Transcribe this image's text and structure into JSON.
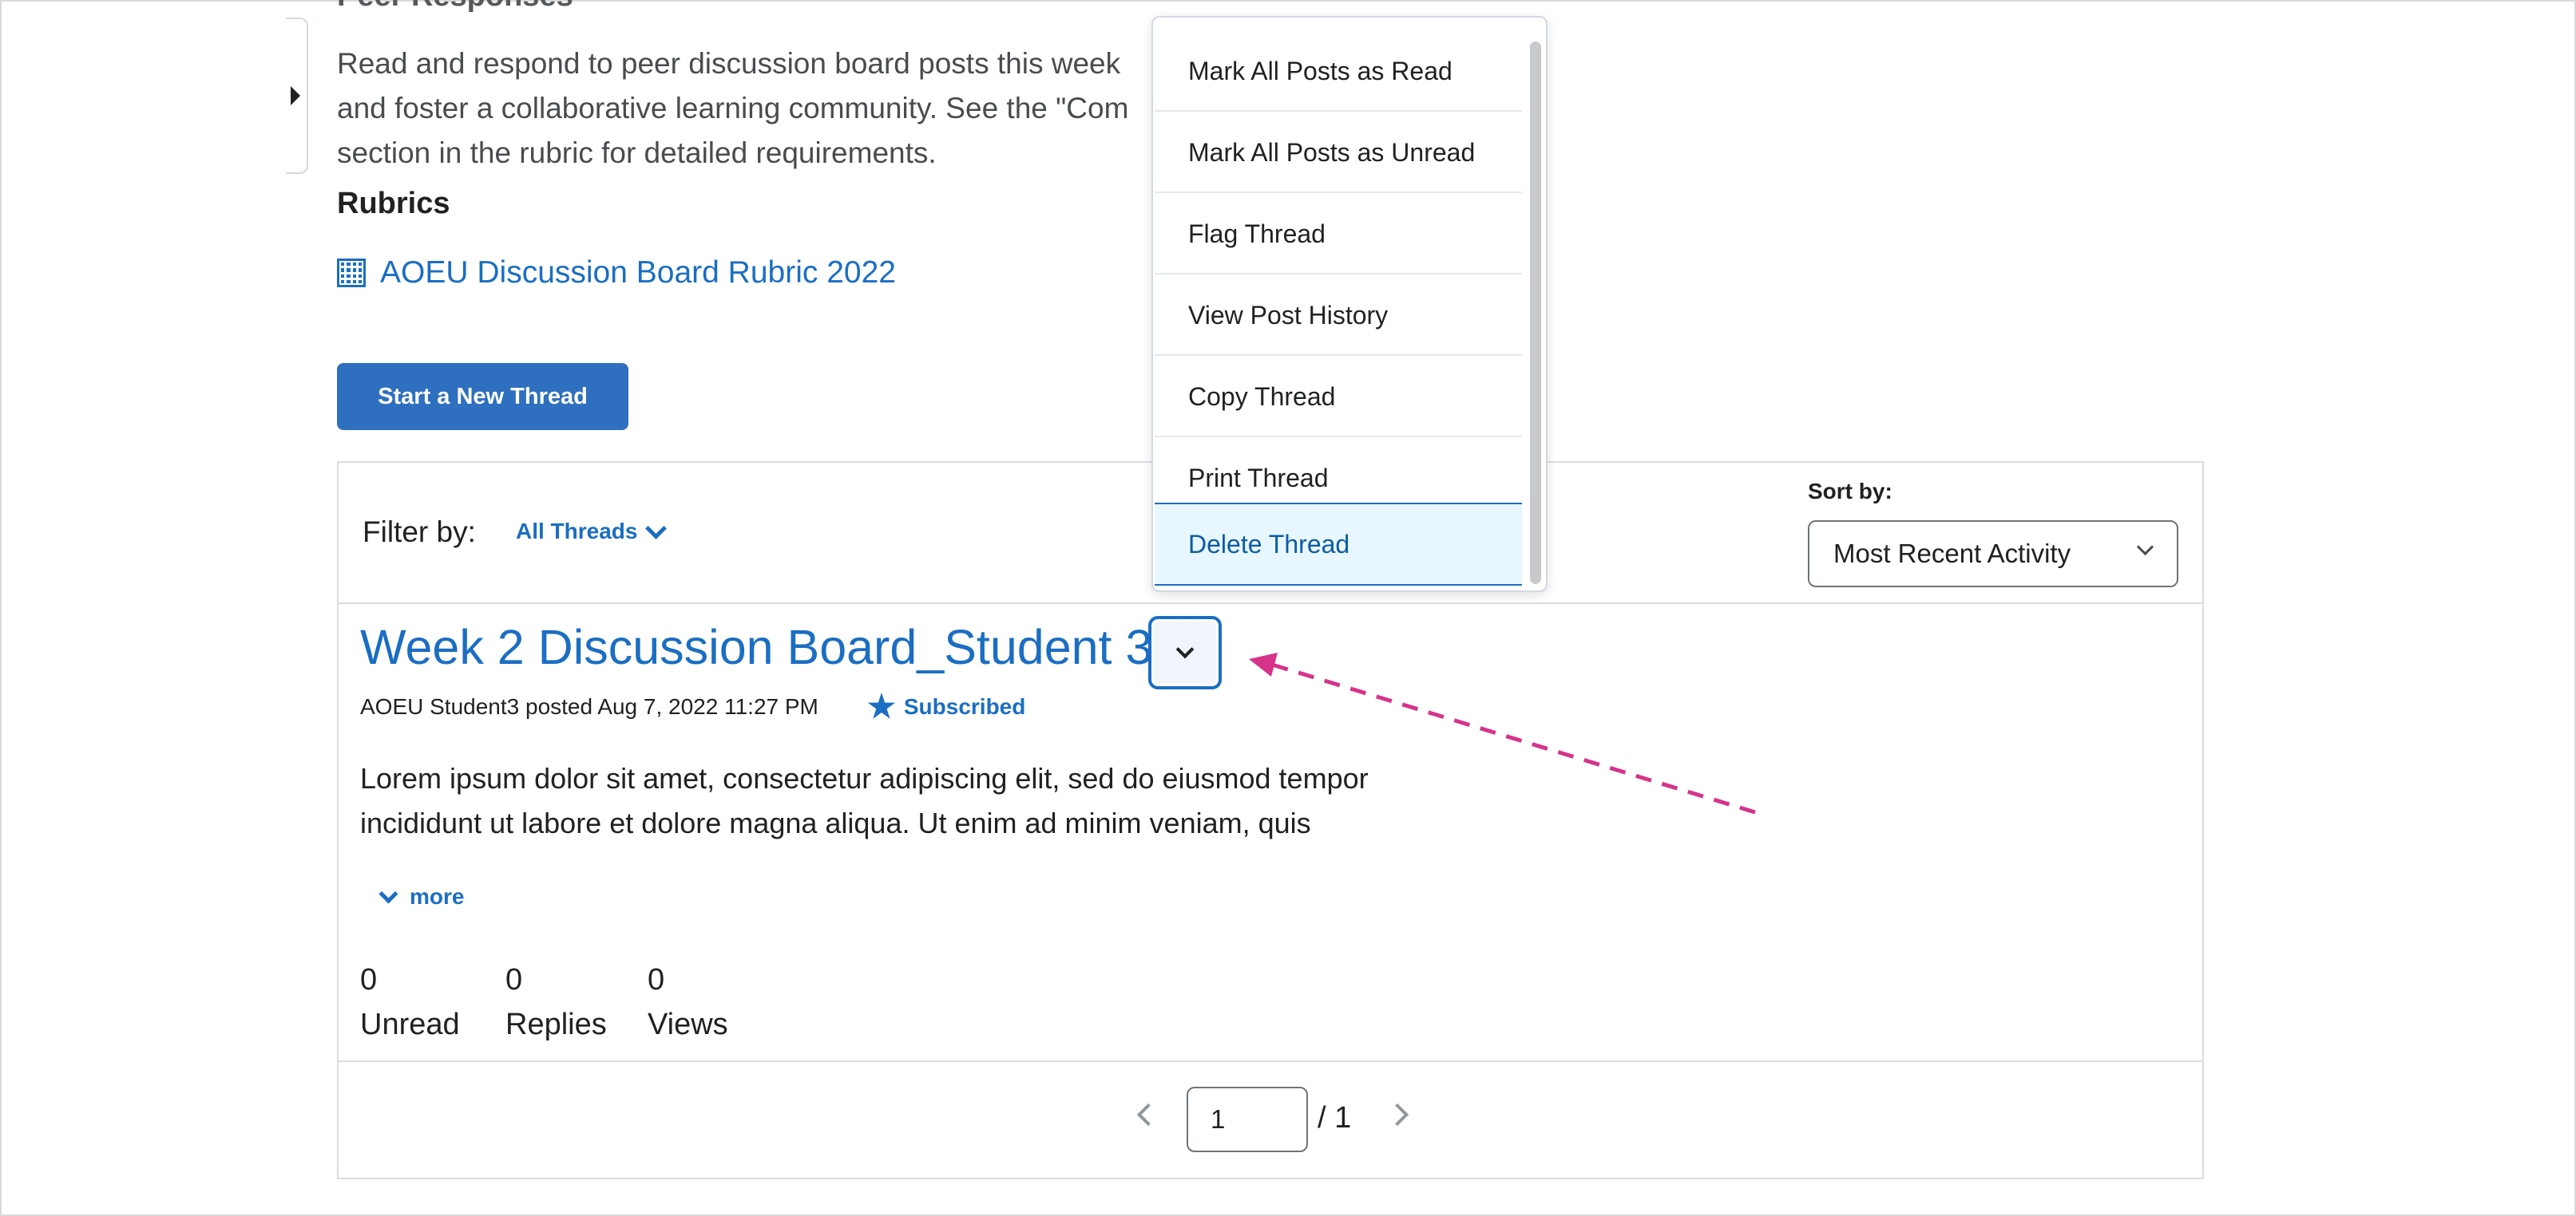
{
  "page": {
    "section_heading": "Peer Responses",
    "description_lines": [
      "Read and respond to peer discussion board posts this week",
      "and foster a collaborative learning community. See the \"Com",
      "section in the rubric for detailed requirements."
    ],
    "rubrics_heading": "Rubrics",
    "rubric_link": "AOEU Discussion Board Rubric 2022",
    "start_thread_button": "Start a New Thread"
  },
  "toolbar": {
    "filter_label": "Filter by:",
    "filter_value": "All Threads",
    "sort_label": "Sort by:",
    "sort_value": "Most Recent Activity"
  },
  "thread": {
    "title": "Week 2 Discussion Board_Student 3",
    "meta": "AOEU Student3 posted Aug 7, 2022 11:27 PM",
    "subscribed": "Subscribed",
    "body_lines": [
      "Lorem ipsum dolor sit amet, consectetur adipiscing elit, sed do eiusmod tempor",
      "incididunt ut labore et dolore magna aliqua. Ut enim ad minim veniam, quis"
    ],
    "more": "more",
    "stats": [
      {
        "value": "0",
        "label": "Unread"
      },
      {
        "value": "0",
        "label": "Replies"
      },
      {
        "value": "0",
        "label": "Views"
      }
    ]
  },
  "pagination": {
    "current": "1",
    "total": "/ 1"
  },
  "context_menu": {
    "items": [
      "Mark All Posts as Read",
      "Mark All Posts as Unread",
      "Flag Thread",
      "View Post History",
      "Copy Thread",
      "Print Thread",
      "Delete Thread"
    ],
    "active_item": "Delete Thread"
  },
  "colors": {
    "link": "#1b6ec2",
    "primary_button": "#2e6fbf",
    "annotation_arrow": "#d6338a",
    "menu_active_bg": "#e7f7fd"
  }
}
